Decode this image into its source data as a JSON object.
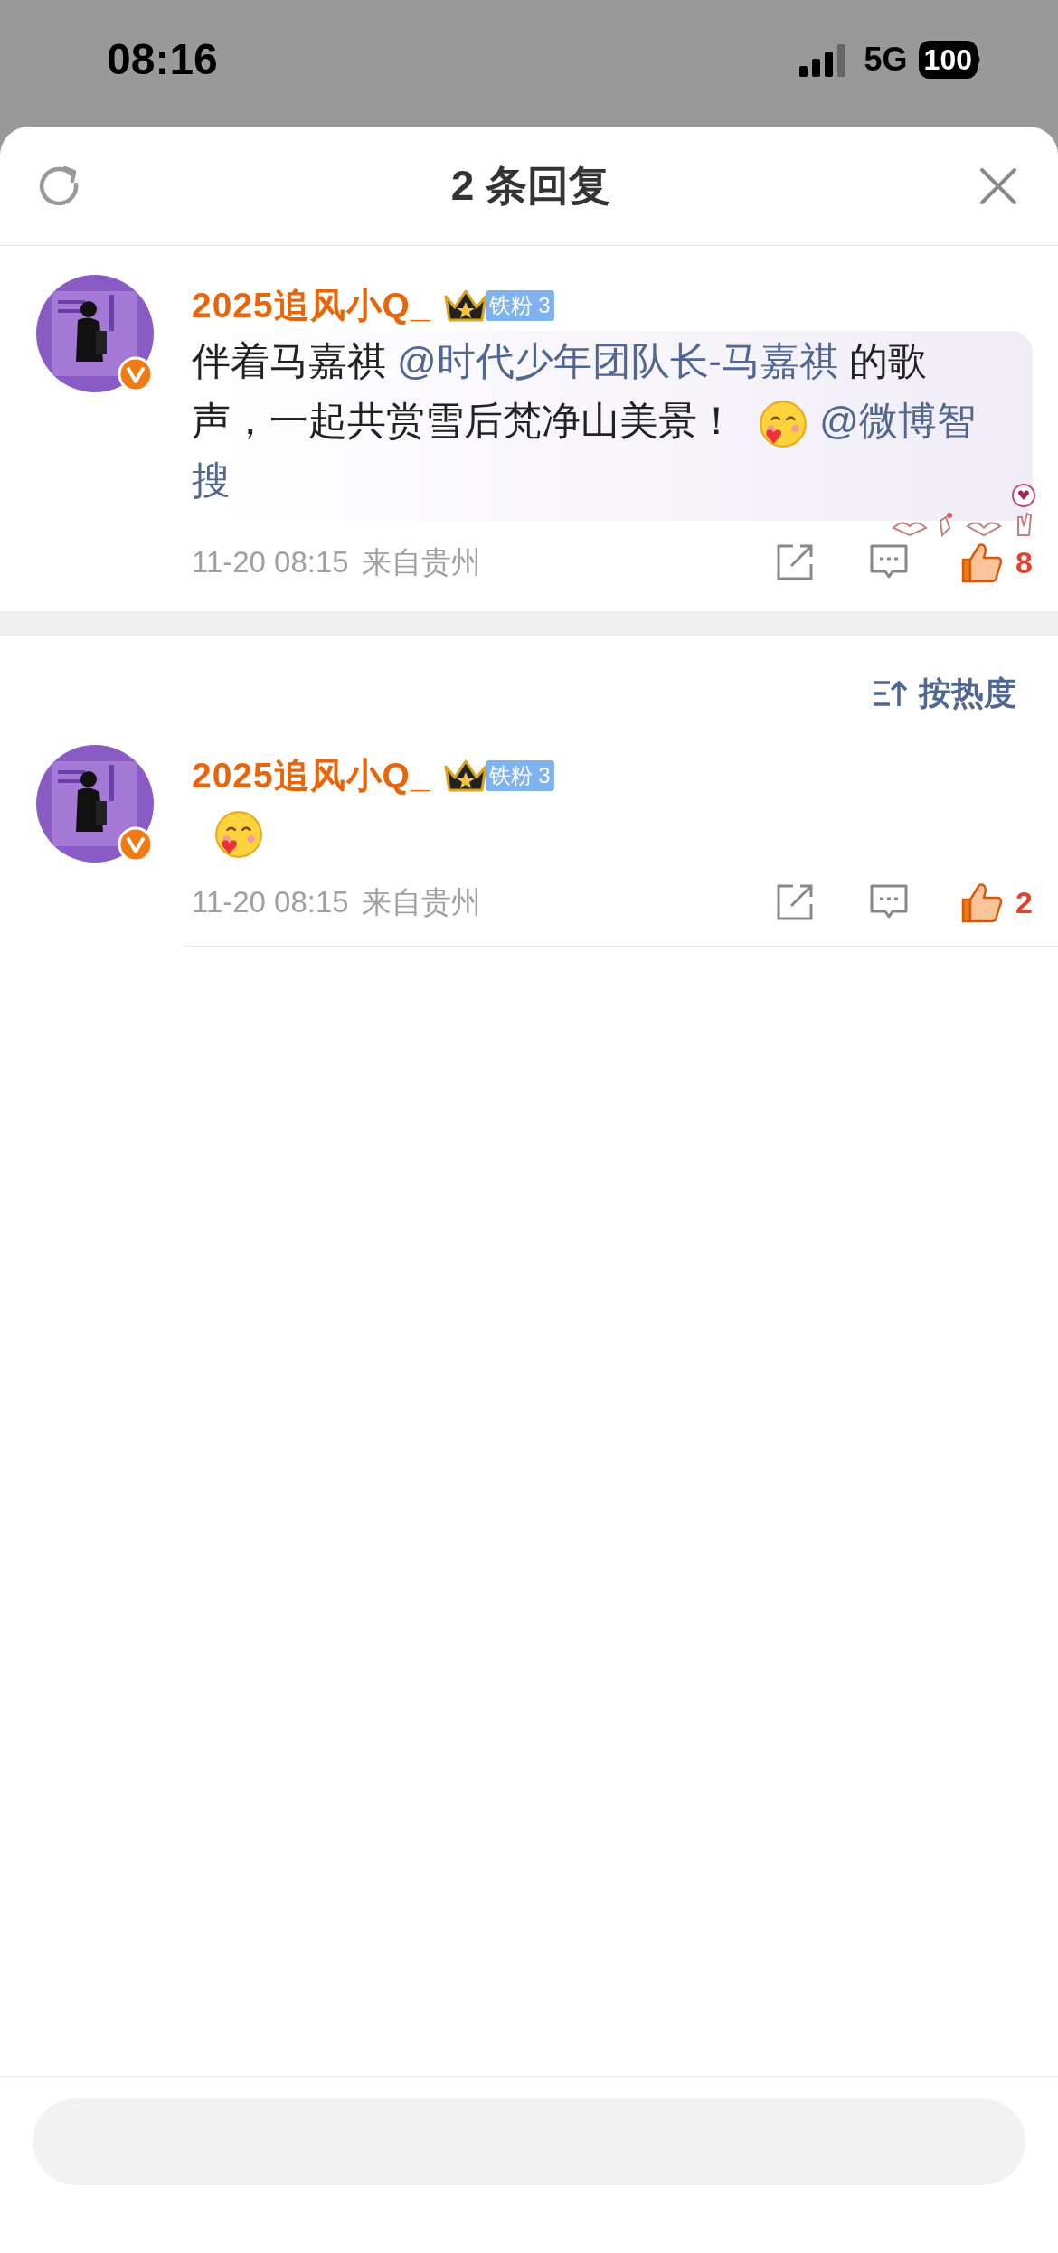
{
  "status_bar": {
    "time": "08:16",
    "network": "5G",
    "battery": "100"
  },
  "sheet": {
    "title": "2 条回复"
  },
  "root_comment": {
    "user": "2025追风小Q_",
    "fan_badge": "铁粉 3",
    "verified": true,
    "highlighted": true,
    "content": [
      {
        "kind": "text",
        "text": "伴着马嘉祺 "
      },
      {
        "kind": "mention",
        "text": "@时代少年团队长-马嘉祺"
      },
      {
        "kind": "text",
        "text": " 的歌声，一起共赏雪后梵净山美景！"
      },
      {
        "kind": "emoji"
      },
      {
        "kind": "mention",
        "text": "@微博智搜"
      }
    ],
    "time": "11-20 08:15",
    "location": "来自贵州",
    "liked": true,
    "likes": "8"
  },
  "sort": {
    "label": "按热度"
  },
  "replies": [
    {
      "user": "2025追风小Q_",
      "fan_badge": "铁粉 3",
      "verified": true,
      "highlighted": false,
      "content": [
        {
          "kind": "emoji"
        }
      ],
      "time": "11-20 08:15",
      "location": "来自贵州",
      "liked": true,
      "likes": "2"
    }
  ]
}
